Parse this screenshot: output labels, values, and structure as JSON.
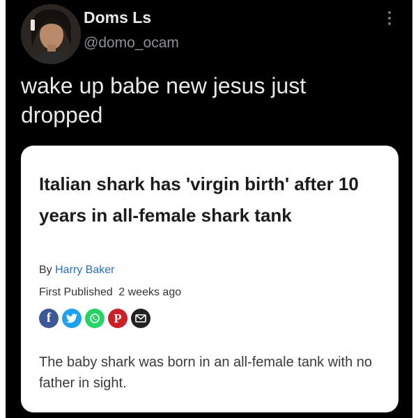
{
  "tweet": {
    "display_name": "Doms Ls",
    "handle": "@domo_ocam",
    "text": "wake up babe new jesus just dropped"
  },
  "article": {
    "headline": "Italian shark has 'virgin birth' after 10 years in all-female shark tank",
    "byline_prefix": "By",
    "author": "Harry Baker",
    "published_label": "First Published",
    "published_value": "2 weeks ago",
    "summary": "The baby shark was born in an all-female tank with no father in sight.",
    "share_icons": [
      {
        "name": "facebook-icon",
        "glyph": "f",
        "color": "#3b5998"
      },
      {
        "name": "twitter-icon",
        "glyph": "",
        "color": "#1da1f2"
      },
      {
        "name": "whatsapp-icon",
        "glyph": "",
        "color": "#25d366"
      },
      {
        "name": "pinterest-icon",
        "glyph": "P",
        "color": "#cb2027"
      },
      {
        "name": "email-icon",
        "glyph": "",
        "color": "#222222"
      }
    ]
  },
  "colors": {
    "background": "#000000",
    "text_primary": "#e7e9ea",
    "text_secondary": "#8b9196",
    "card_background": "#ffffff",
    "author_link": "#2a6ebb"
  }
}
